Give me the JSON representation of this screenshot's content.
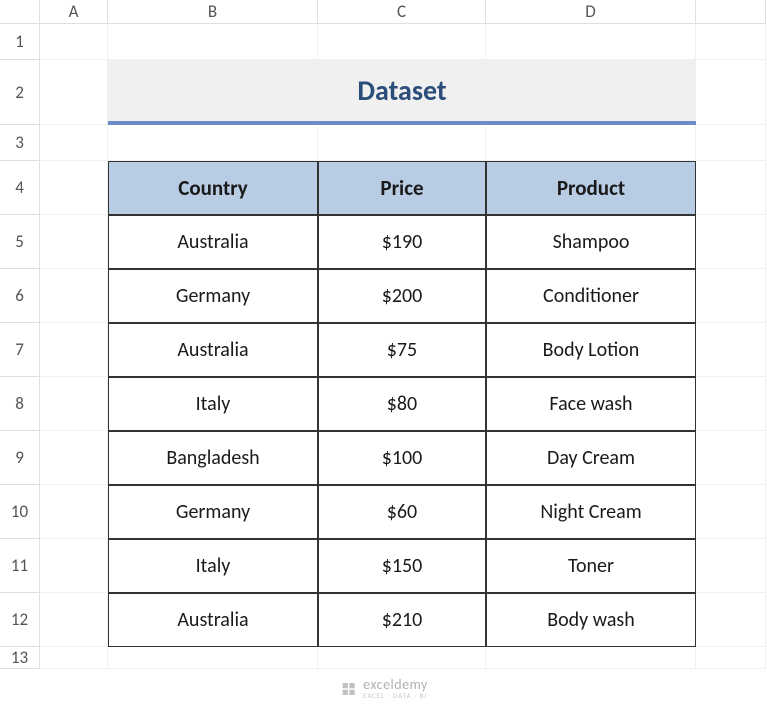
{
  "columns": [
    "",
    "A",
    "B",
    "C",
    "D",
    ""
  ],
  "rows": [
    "1",
    "2",
    "3",
    "4",
    "5",
    "6",
    "7",
    "8",
    "9",
    "10",
    "11",
    "12",
    "13"
  ],
  "title": "Dataset",
  "headers": {
    "country": "Country",
    "price": "Price",
    "product": "Product"
  },
  "data": [
    {
      "country": "Australia",
      "price": "$190",
      "product": "Shampoo"
    },
    {
      "country": "Germany",
      "price": "$200",
      "product": "Conditioner"
    },
    {
      "country": "Australia",
      "price": "$75",
      "product": "Body Lotion"
    },
    {
      "country": "Italy",
      "price": "$80",
      "product": "Face wash"
    },
    {
      "country": "Bangladesh",
      "price": "$100",
      "product": "Day Cream"
    },
    {
      "country": "Germany",
      "price": "$60",
      "product": "Night Cream"
    },
    {
      "country": "Italy",
      "price": "$150",
      "product": "Toner"
    },
    {
      "country": "Australia",
      "price": "$210",
      "product": "Body wash"
    }
  ],
  "watermark": {
    "main": "exceldemy",
    "sub": "EXCEL · DATA · BI"
  }
}
